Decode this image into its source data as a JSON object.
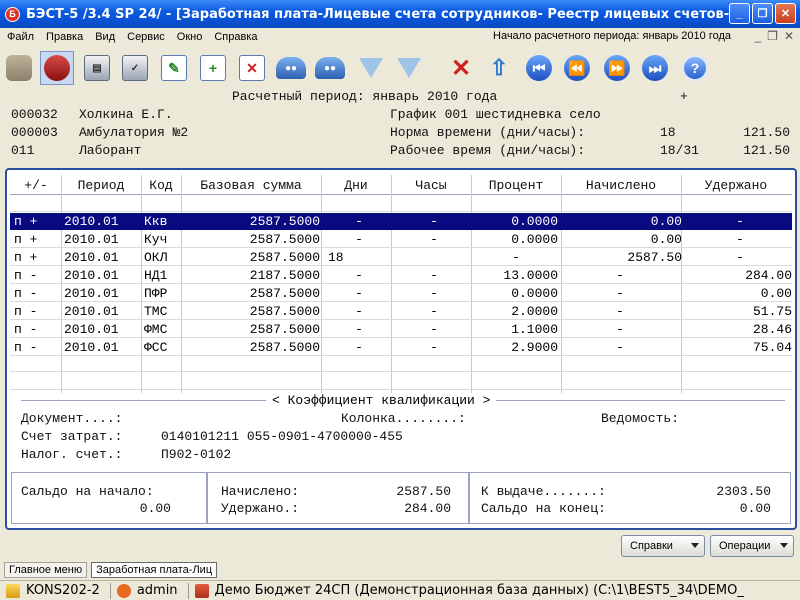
{
  "window": {
    "title": "БЭСТ-5 /3.4 SP 24/ - [Заработная плата-Лицевые счета сотрудников- Реестр лицевых счетов-Индивидуаль...",
    "minimize": "_",
    "restore": "❐",
    "close": "✕"
  },
  "menu": {
    "items": [
      "Файл",
      "Правка",
      "Вид",
      "Сервис",
      "Окно",
      "Справка"
    ],
    "period": "Начало расчетного периода: январь 2010 года",
    "mdi_min": "_",
    "mdi_restore": "❐",
    "mdi_close": "✕"
  },
  "header": {
    "period_line": "Расчетный период: январь 2010 года",
    "plus": "+",
    "emp_code": "000032",
    "emp_name": "Холкина Е.Г.",
    "dept_code": "000003",
    "dept_name": "Амбулатория №2",
    "pos_code": "011",
    "pos_name": "Лаборант",
    "schedule": "График 001 шестидневка село",
    "norm_label": "Норма времени (дни/часы):",
    "norm_days": "18",
    "norm_hours": "121.50",
    "work_label": "Рабочее время (дни/часы):",
    "work_days": "18/31",
    "work_hours": "121.50"
  },
  "grid": {
    "columns": [
      "+/-",
      "Период",
      "Код",
      "Базовая сумма",
      "Дни",
      "Часы",
      "Процент",
      "Начислено",
      "Удержано"
    ],
    "rows": [
      {
        "sign": "п +",
        "period": "2010.01",
        "code": "Ккв",
        "base": "2587.5000",
        "days": "-",
        "hours": "-",
        "pct": "0.0000",
        "accrued": "0.00",
        "withheld": "-"
      },
      {
        "sign": "п +",
        "period": "2010.01",
        "code": "Куч",
        "base": "2587.5000",
        "days": "-",
        "hours": "-",
        "pct": "0.0000",
        "accrued": "0.00",
        "withheld": "-"
      },
      {
        "sign": "п +",
        "period": "2010.01",
        "code": "ОКЛ",
        "base": "2587.5000",
        "days": "18",
        "hours": "",
        "pct": "-",
        "accrued": "2587.50",
        "withheld": "-"
      },
      {
        "sign": "п -",
        "period": "2010.01",
        "code": "НД1",
        "base": "2187.5000",
        "days": "-",
        "hours": "-",
        "pct": "13.0000",
        "accrued": "-",
        "withheld": "284.00"
      },
      {
        "sign": "п -",
        "period": "2010.01",
        "code": "ПФР",
        "base": "2587.5000",
        "days": "-",
        "hours": "-",
        "pct": "0.0000",
        "accrued": "-",
        "withheld": "0.00"
      },
      {
        "sign": "п -",
        "period": "2010.01",
        "code": "ТМС",
        "base": "2587.5000",
        "days": "-",
        "hours": "-",
        "pct": "2.0000",
        "accrued": "-",
        "withheld": "51.75"
      },
      {
        "sign": "п -",
        "period": "2010.01",
        "code": "ФМС",
        "base": "2587.5000",
        "days": "-",
        "hours": "-",
        "pct": "1.1000",
        "accrued": "-",
        "withheld": "28.46"
      },
      {
        "sign": "п -",
        "period": "2010.01",
        "code": "ФСС",
        "base": "2587.5000",
        "days": "-",
        "hours": "-",
        "pct": "2.9000",
        "accrued": "-",
        "withheld": "75.04"
      }
    ]
  },
  "details": {
    "section": "< Коэффициент квалификации >",
    "document": "Документ....:",
    "column": "Колонка........:",
    "sheet": "Ведомость:",
    "cost_label": "Счет затрат.:",
    "cost_value": "0140101211 055-0901-4700000-455",
    "tax_label": "Налог. счет.:",
    "tax_value": "П902-0102"
  },
  "totals": {
    "start_label": "Сальдо на начало:",
    "start_value": "0.00",
    "accrued_label": "Начислено:",
    "accrued_value": "2587.50",
    "withheld_label": "Удержано.:",
    "withheld_value": "284.00",
    "payout_label": "К выдаче.......:",
    "payout_value": "2303.50",
    "end_label": "Сальдо на конец:",
    "end_value": "0.00"
  },
  "buttons": {
    "help": "Справки",
    "operations": "Операции"
  },
  "tabs": [
    "Главное меню",
    "Заработная плата-Лиц"
  ],
  "status": {
    "host": "KONS202-2",
    "user": "admin",
    "db": "Демо Бюджет 24СП (Демонстрационная база данных) (C:\\1\\BEST5_34\\DEMO_"
  }
}
